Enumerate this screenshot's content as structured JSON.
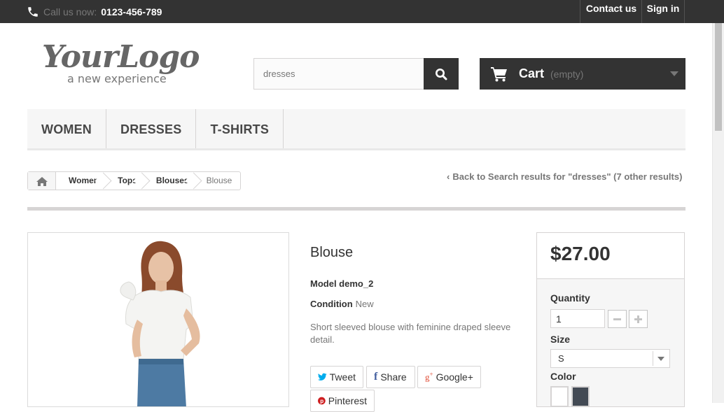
{
  "topbar": {
    "phone_label": "Call us now:",
    "phone_number": "0123-456-789",
    "contact_label": "Contact us",
    "signin_label": "Sign in"
  },
  "header": {
    "logo_text": "YourLogo",
    "logo_tagline": "a new experience",
    "search_value": "dresses",
    "cart_label": "Cart",
    "cart_status": "(empty)"
  },
  "menu": {
    "items": [
      "Women",
      "Dresses",
      "T-shirts"
    ]
  },
  "breadcrumb": {
    "items": [
      "Women",
      "Tops",
      "Blouses"
    ],
    "current": "Blouse"
  },
  "back_link": "Back to Search results for \"dresses\" (7 other results)",
  "product": {
    "name": "Blouse",
    "reference": "Model demo_2",
    "condition_label": "Condition",
    "condition_value": "New",
    "description": "Short sleeved blouse with feminine draped sleeve detail.",
    "price": "$27.00"
  },
  "social": {
    "tweet": "Tweet",
    "share": "Share",
    "google": "Google+",
    "pinterest": "Pinterest"
  },
  "buy": {
    "quantity_label": "Quantity",
    "quantity_value": "1",
    "size_label": "Size",
    "size_value": "S",
    "color_label": "Color",
    "colors": [
      "#ffffff",
      "#434a54"
    ]
  }
}
